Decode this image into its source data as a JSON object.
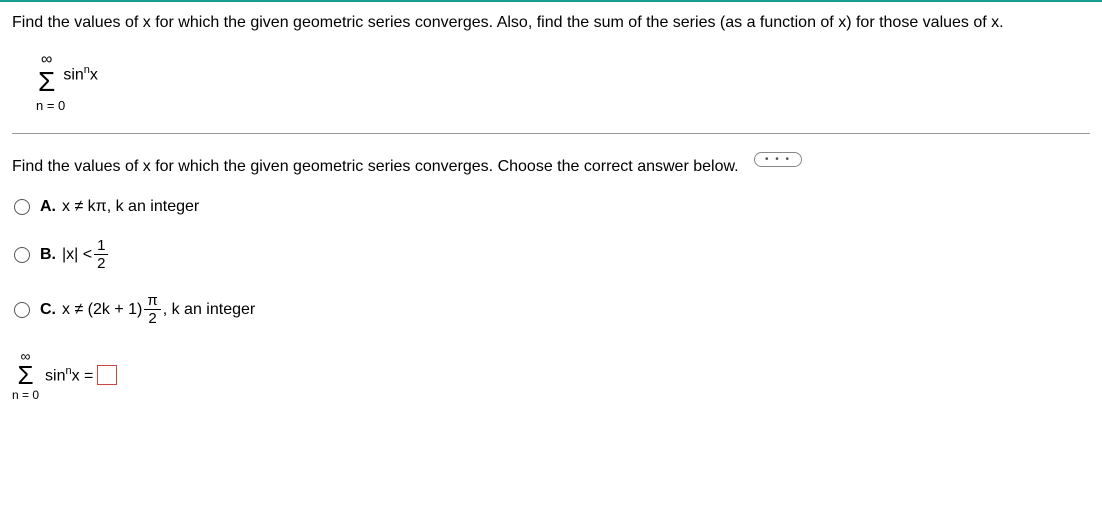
{
  "question": "Find the values of x for which the given geometric series converges. Also, find the sum of the series (as a function of x) for those values of x.",
  "series": {
    "upper": "∞",
    "symbol": "Σ",
    "expr_base": "sin",
    "expr_sup": "n",
    "expr_var": "x",
    "lower": "n = 0"
  },
  "more_label": "•  •  •",
  "sub_question": "Find the values of x for which the given geometric series converges. Choose the correct answer below.",
  "options": {
    "a": {
      "letter": "A.",
      "text_pre": "x ≠ kπ, k an integer"
    },
    "b": {
      "letter": "B.",
      "text_pre": "|x| <",
      "frac_num": "1",
      "frac_den": "2"
    },
    "c": {
      "letter": "C.",
      "text_pre": "x ≠ (2k + 1)",
      "frac_num": "π",
      "frac_den": "2",
      "text_post": ", k an integer"
    }
  },
  "answer": {
    "upper": "∞",
    "symbol": "Σ",
    "lower": "n = 0",
    "expr_base": "sin",
    "expr_sup": "n",
    "expr_var": "x =",
    "box_value": ""
  }
}
